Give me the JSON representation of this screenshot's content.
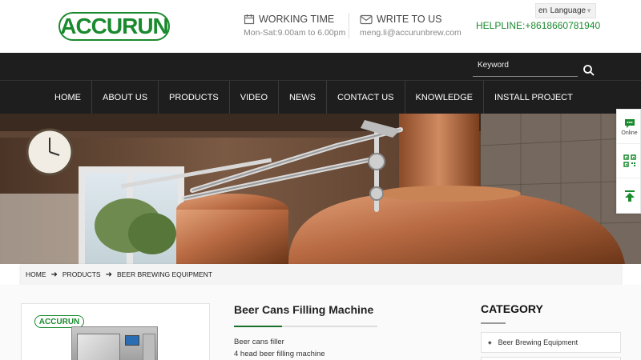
{
  "header": {
    "logo_text": "ACCURUN",
    "working_title": "WORKING TIME",
    "working_hours": "Mon-Sat:9.00am to 6.00pm",
    "write_title": "WRITE TO US",
    "email": "meng.li@accurunbrew.com",
    "helpline": "HELPLINE:+8618660781940",
    "language_code": "en",
    "language_label": "Language"
  },
  "search": {
    "placeholder": "Keyword"
  },
  "nav": {
    "items": [
      "HOME",
      "ABOUT US",
      "PRODUCTS",
      "VIDEO",
      "NEWS",
      "CONTACT US",
      "KNOWLEDGE",
      "INSTALL PROJECT"
    ]
  },
  "breadcrumb": [
    "HOME",
    "PRODUCTS",
    "BEER BREWING EQUIPMENT"
  ],
  "product": {
    "logo_text": "ACCURUN",
    "title": "Beer Cans Filling Machine",
    "lines": [
      "Beer cans filler",
      "4 head beer filling machine"
    ]
  },
  "category": {
    "title": "CATEGORY",
    "items": [
      "Beer Brewing Equipment"
    ]
  },
  "side_tools": {
    "online_label": "Online"
  },
  "colors": {
    "brand_green": "#1a8a2e",
    "nav_dark": "#1e1e1e"
  }
}
